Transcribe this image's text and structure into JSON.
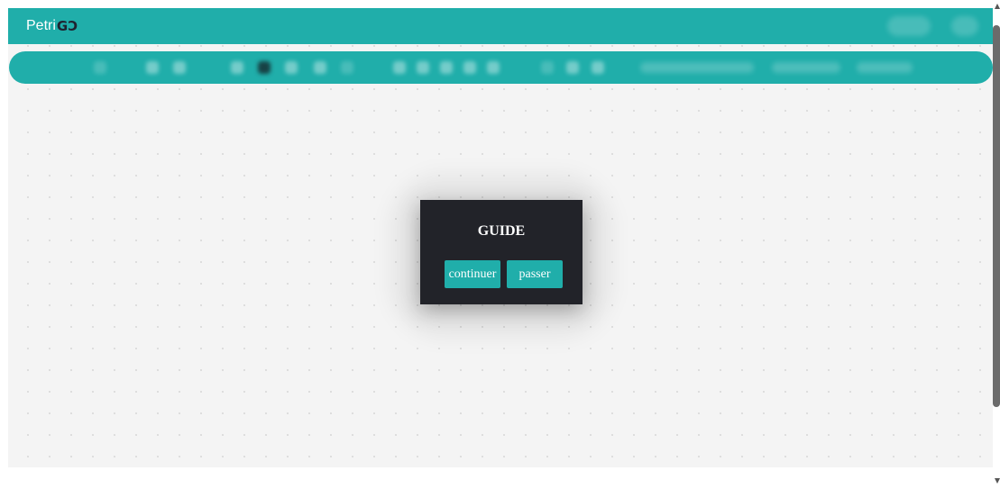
{
  "header": {
    "brand_text": "Petri",
    "brand_mark": "GƆ"
  },
  "dialog": {
    "title": "GUIDE",
    "continue_label": "continuer",
    "skip_label": "passer"
  },
  "colors": {
    "accent": "#20aeaa",
    "dialog_bg": "#222329",
    "canvas_bg": "#f4f4f4"
  }
}
